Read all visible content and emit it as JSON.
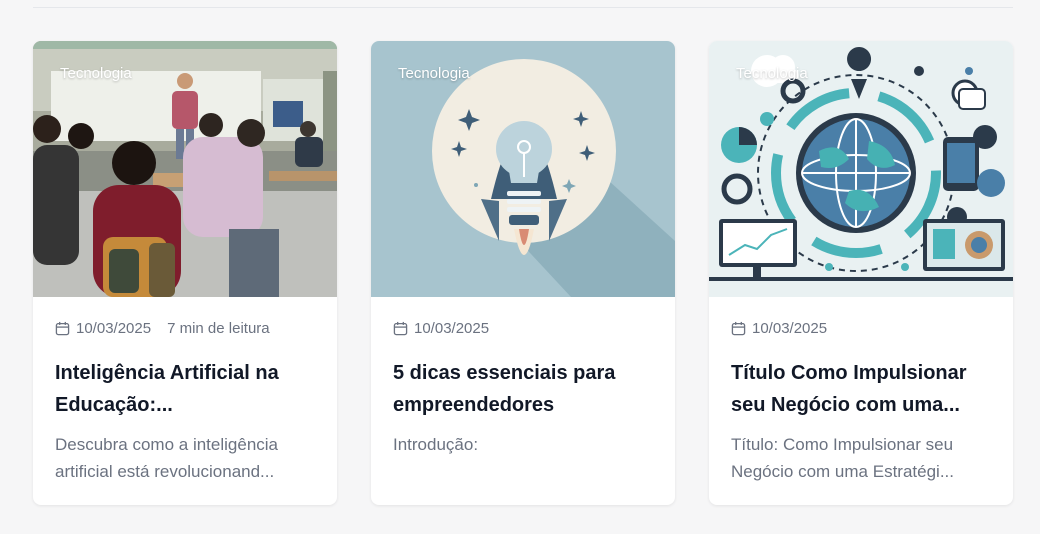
{
  "posts": [
    {
      "category": "Tecnologia",
      "date": "10/03/2025",
      "read_time": "7 min de leitura",
      "title": "Inteligência Artificial na Educação:...",
      "excerpt": "Descubra como a inteligência artificial está revolucionand...",
      "image": "classroom-photo"
    },
    {
      "category": "Tecnologia",
      "date": "10/03/2025",
      "title": "5 dicas essenciais para empreendedores",
      "excerpt": "Introdução:",
      "image": "lightbulb-rocket-illustration"
    },
    {
      "category": "Tecnologia",
      "date": "10/03/2025",
      "title": "Título Como Impulsionar seu Negócio com uma...",
      "excerpt": "Título: Como Impulsionar seu Negócio com uma Estratégi...",
      "image": "digital-globe-illustration"
    }
  ],
  "colors": {
    "background": "#f6f6f7",
    "card": "#ffffff",
    "title": "#111827",
    "muted": "#6b7280"
  }
}
